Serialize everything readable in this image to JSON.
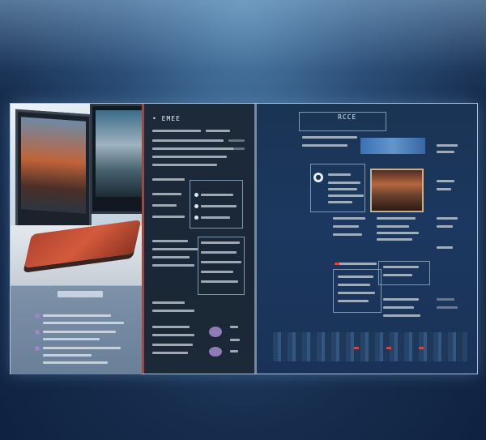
{
  "panels": {
    "mid_title": "• EMEE",
    "right_title": "RCCE"
  },
  "colors": {
    "frame_border": "#a9c3dc",
    "accent_red": "#c23a2e",
    "panel_dark": "#1d2a3a",
    "panel_blue": "#1c3860"
  },
  "icons": {
    "app_logo": "circle-logo-icon"
  }
}
